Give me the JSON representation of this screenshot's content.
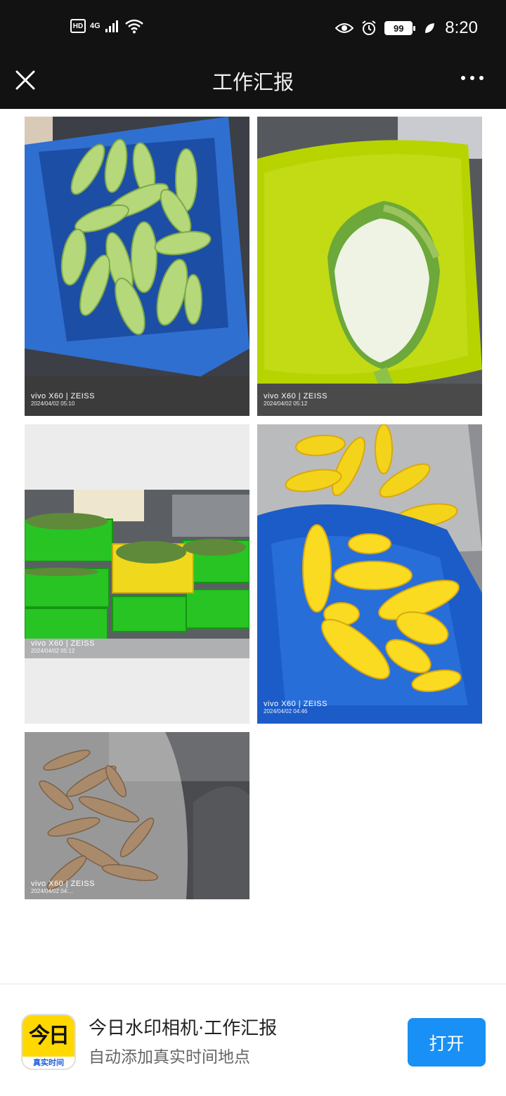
{
  "status_bar": {
    "hd": "HD",
    "network": "4G",
    "battery": "99",
    "time": "8:20"
  },
  "nav": {
    "title": "工作汇报",
    "close_icon": "close-icon",
    "more_icon": "more-dots-icon"
  },
  "photos": [
    {
      "subject": "zucchini",
      "brand": "vivo X60 | ZEISS",
      "date": "2024/04/02 05:10"
    },
    {
      "subject": "napa-cabbage",
      "brand": "vivo X60 | ZEISS",
      "date": "2024/04/02 05:12"
    },
    {
      "subject": "green-peppers-baskets",
      "brand": "vivo X60 | ZEISS",
      "date": "2024/04/02 05:12"
    },
    {
      "subject": "corn",
      "brand": "vivo X60 | ZEISS",
      "date": "2024/04/02 04:46"
    },
    {
      "subject": "yams",
      "brand": "vivo X60 | ZEISS",
      "date": "2024/04/02 04:..."
    }
  ],
  "banner": {
    "icon_big": "今日",
    "icon_small": "真实时间",
    "title": "今日水印相机·工作汇报",
    "subtitle": "自动添加真实时间地点",
    "open_label": "打开",
    "accent": "#1890f5"
  }
}
